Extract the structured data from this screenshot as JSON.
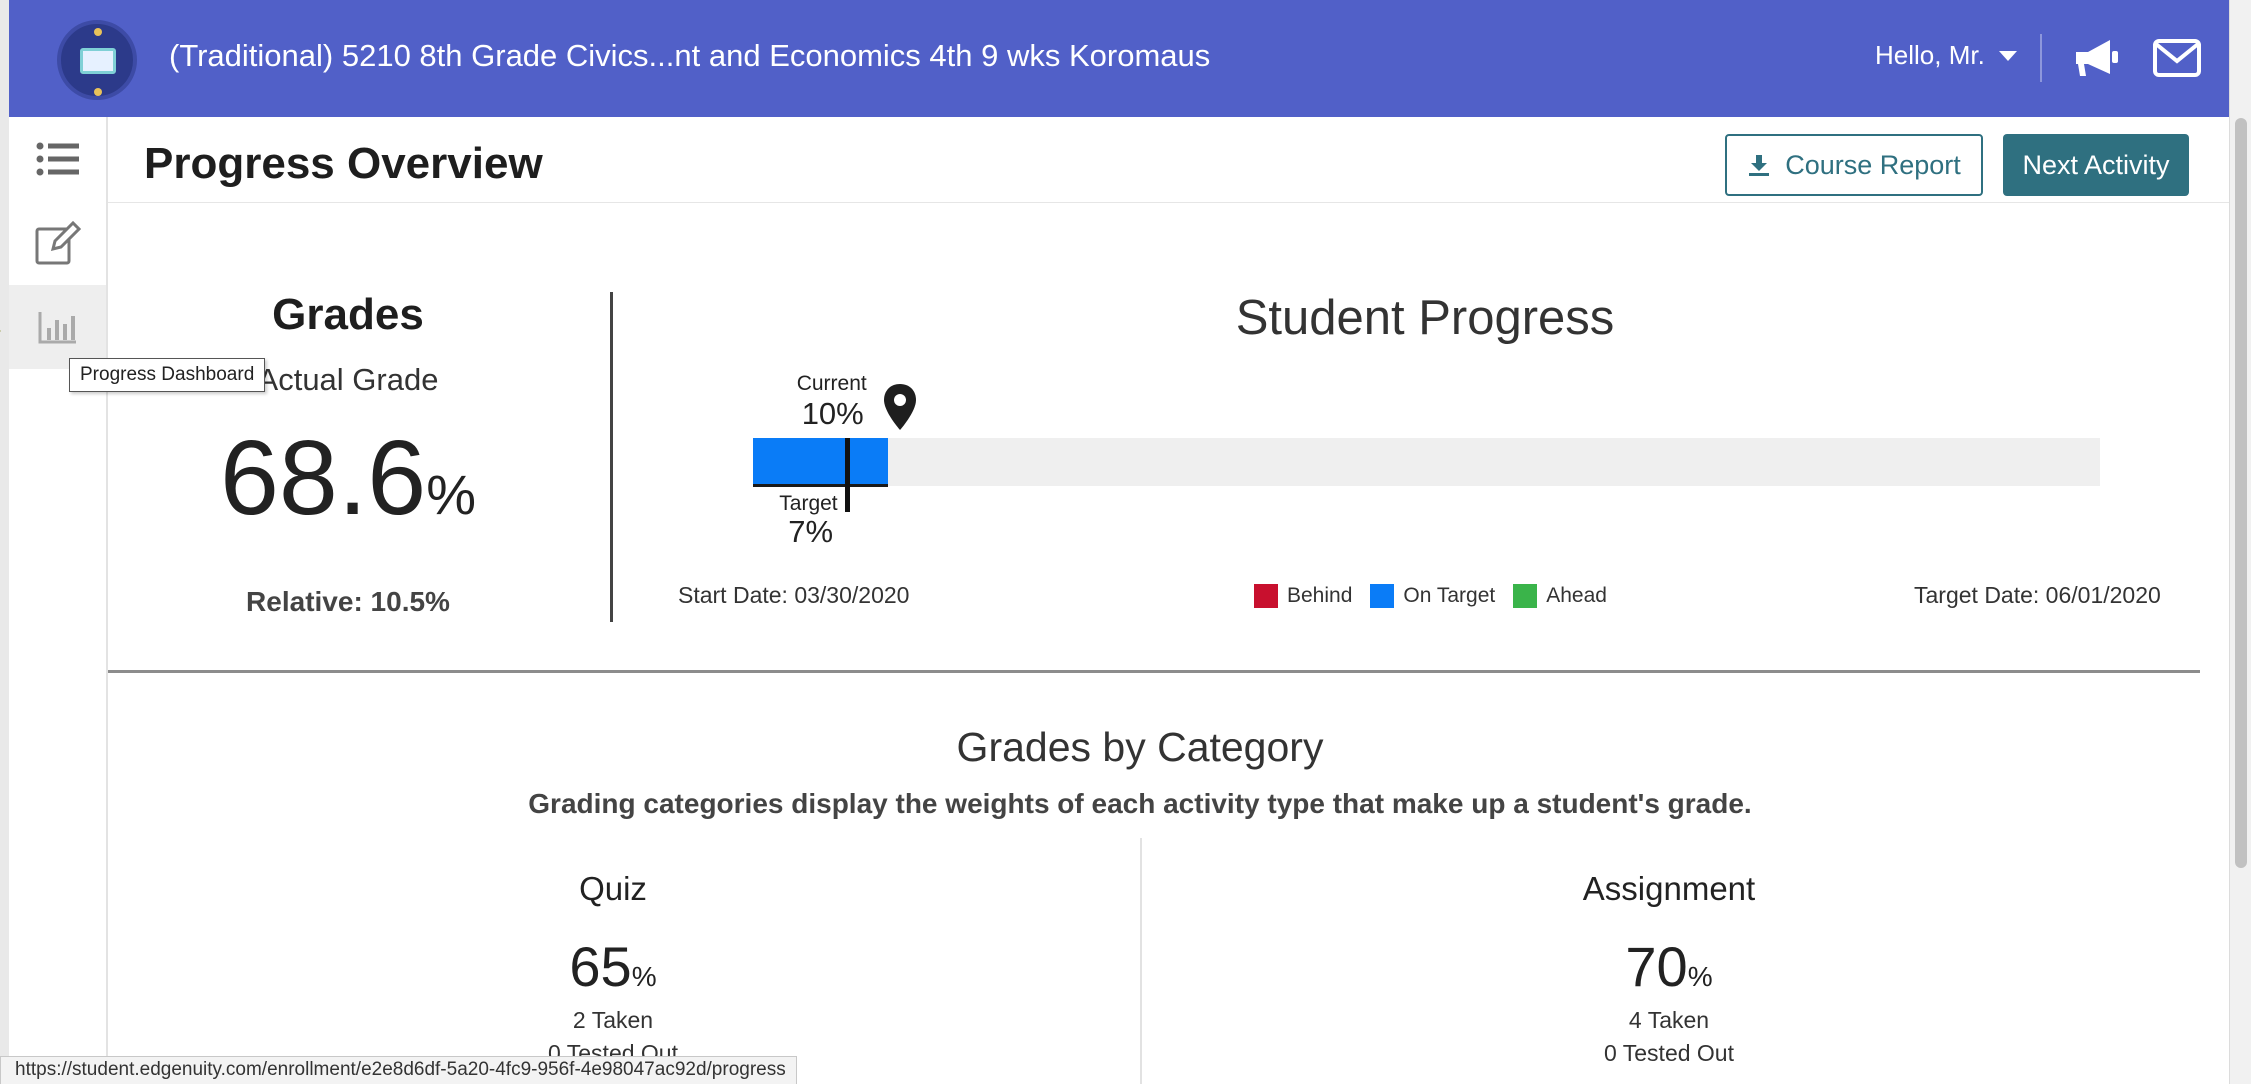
{
  "header": {
    "course_title": "(Traditional) 5210 8th Grade Civics...nt and Economics 4th 9 wks Koromaus",
    "greeting": "Hello, Mr.",
    "brand_color": "#5160c8"
  },
  "sidebar": {
    "items": [
      {
        "icon": "list-icon",
        "label": ""
      },
      {
        "icon": "edit-icon",
        "label": ""
      },
      {
        "icon": "bar-chart-icon",
        "label": ""
      }
    ],
    "tooltip": "Progress Dashboard"
  },
  "page": {
    "title": "Progress Overview",
    "course_report_label": "Course Report",
    "next_activity_label": "Next Activity",
    "accent_color": "#2f7080"
  },
  "grades": {
    "heading": "Grades",
    "actual_label": "Actual Grade",
    "actual_value": "68.6",
    "actual_unit": "%",
    "relative": "Relative: 10.5%"
  },
  "progress": {
    "title": "Student Progress",
    "current_label": "Current",
    "current_value": "10%",
    "current_percent": 10,
    "target_label": "Target",
    "target_value": "7%",
    "target_percent": 7,
    "start_date": "Start Date: 03/30/2020",
    "target_date": "Target Date: 06/01/2020",
    "legend": [
      {
        "label": "Behind",
        "color": "#c8102e"
      },
      {
        "label": "On Target",
        "color": "#0a7cf7"
      },
      {
        "label": "Ahead",
        "color": "#3ab44a"
      }
    ]
  },
  "categories": {
    "title": "Grades by Category",
    "subtitle": "Grading categories display the weights of each activity type that make up a student's grade.",
    "items": [
      {
        "name": "Quiz",
        "value": "65",
        "unit": "%",
        "taken": "2 Taken",
        "tested_out": "0 Tested Out"
      },
      {
        "name": "Assignment",
        "value": "70",
        "unit": "%",
        "taken": "4 Taken",
        "tested_out": "0 Tested Out"
      }
    ]
  },
  "statusbar": {
    "url": "https://student.edgenuity.com/enrollment/e2e8d6df-5a20-4fc9-956f-4e98047ac92d/progress"
  }
}
